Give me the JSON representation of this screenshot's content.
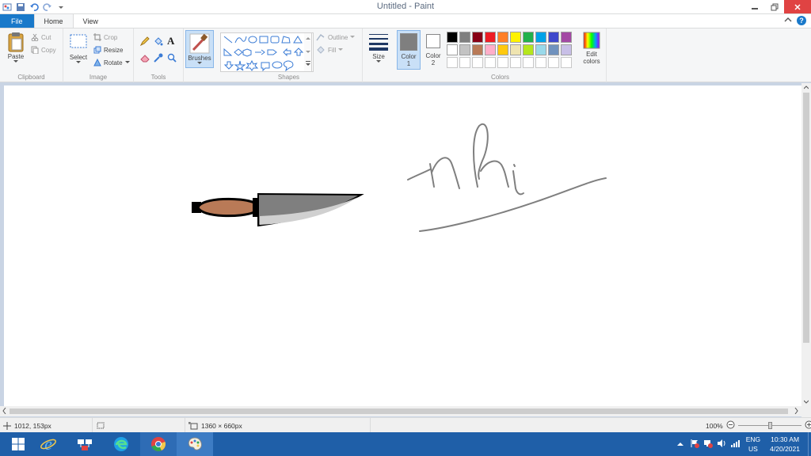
{
  "window": {
    "title": "Untitled - Paint"
  },
  "tabs": [
    {
      "label": "File"
    },
    {
      "label": "Home"
    },
    {
      "label": "View"
    }
  ],
  "ribbon": {
    "clipboard": {
      "label": "Clipboard",
      "paste": "Paste",
      "cut": "Cut",
      "copy": "Copy"
    },
    "image": {
      "label": "Image",
      "select": "Select",
      "crop": "Crop",
      "resize": "Resize",
      "rotate": "Rotate"
    },
    "tools": {
      "label": "Tools"
    },
    "brushes": {
      "label": "Brushes"
    },
    "shapes": {
      "label": "Shapes",
      "outline": "Outline",
      "fill": "Fill"
    },
    "size": {
      "label": "Size"
    },
    "colors": {
      "label": "Colors",
      "color1_label": "Color",
      "color1_num": "1",
      "color2_label": "Color",
      "color2_num": "2",
      "color1_value": "#7f7f7f",
      "color2_value": "#ffffff",
      "edit_label": "Edit",
      "edit_label2": "colors",
      "palette_row1": [
        "#000000",
        "#7f7f7f",
        "#880015",
        "#ed1c24",
        "#ff7f27",
        "#fff200",
        "#22b14c",
        "#00a2e8",
        "#3f48cc",
        "#a349a4"
      ],
      "palette_row2": [
        "#ffffff",
        "#c3c3c3",
        "#b97a57",
        "#ffaec9",
        "#ffc90e",
        "#efe4b0",
        "#b5e61d",
        "#99d9ea",
        "#7092be",
        "#c8bfe7"
      ]
    }
  },
  "canvas": {
    "signature_text": "nhi",
    "knife_handle_color": "#b97a57",
    "knife_blade_color": "#7f7f7f"
  },
  "status": {
    "cursor_pos": "1012, 153px",
    "canvas_size": "1360 × 660px",
    "zoom": "100%"
  },
  "taskbar": {
    "language": "ENG",
    "region": "US",
    "time": "10:30 AM",
    "date": "4/20/2021"
  }
}
